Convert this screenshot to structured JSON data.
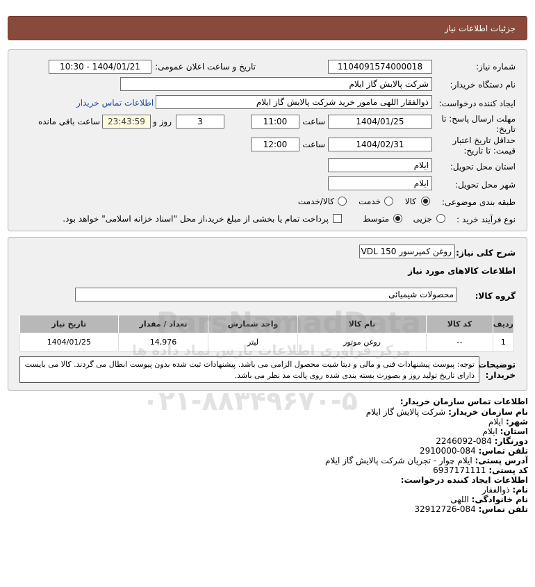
{
  "page_title": "جزئیات اطلاعات نیاز",
  "labels": {
    "need_number": "شماره نیاز:",
    "announce_datetime": "تاریخ و ساعت اعلان عمومی:",
    "buyer_org": "نام دستگاه خریدار:",
    "creator": "ایجاد کننده درخواست:",
    "deadline_line1": "مهلت ارسال پاسخ: تا",
    "deadline_line2": "تاریخ:",
    "hour": "ساعت",
    "days_and": "روز و",
    "remaining": "ساعت باقی مانده",
    "validity_line1": "حداقل تاریخ اعتبار",
    "validity_line2": "قیمت: تا تاریخ:",
    "province": "استان محل تحویل:",
    "city": "شهر محل تحویل:",
    "category": "طبقه بندی موضوعی:",
    "process": "نوع فرآیند خرید :",
    "summary": "شرح کلی نیاز:",
    "goods_info": "اطلاعات کالاهای مورد نیاز",
    "goods_group": "گروه کالا:",
    "notes_line1": "توضیحات",
    "notes_line2": "خریدار:"
  },
  "values": {
    "need_number": "1104091574000018",
    "announce_datetime": "1404/01/21 - 10:30",
    "buyer_org": "شرکت پالایش گاز ایلام",
    "creator": "ذوالفقار اللهی مامور خرید شرکت پالایش گاز ایلام",
    "buyer_contact_link": "اطلاعات تماس خریدار",
    "deadline_date": "1404/01/25",
    "deadline_hour": "11:00",
    "days": "3",
    "timer": "23:43:59",
    "validity_date": "1404/02/31",
    "validity_hour": "12:00",
    "province": "ایلام",
    "city": "ایلام",
    "summary": "روغن کمپرسور VDL 150",
    "goods_group": "محصولات شیمیائی"
  },
  "category_options": [
    "کالا",
    "خدمت",
    "کالا/خدمت"
  ],
  "category_selected": "کالا",
  "process_options": [
    "جزیی",
    "متوسط"
  ],
  "process_selected": "متوسط",
  "payment_note": "پرداخت تمام یا بخشی از مبلغ خرید،از محل \"اسناد خزانه اسلامی\" خواهد بود.",
  "table": {
    "headers": [
      "ردیف",
      "کد کالا",
      "نام کالا",
      "واحد شمارش",
      "تعداد / مقدار",
      "تاریخ نیاز"
    ],
    "rows": [
      [
        "1",
        "--",
        "روغن موتور",
        "لیتر",
        "14,976",
        "1404/01/25"
      ]
    ]
  },
  "notes": "توجه: پیوست پیشنهادات فنی و مالی و دیتا شیت محصول الزامی می باشد. پیشنهادات ثبت شده بدون پیوست ابطال می گردند. کالا می بایست دارای تاریخ تولید روز و بصورت بسته بندی شده روی پالت مد نظر می باشد.",
  "contact": {
    "title": "اطلاعات تماس سازمان خریدار:",
    "org_label": "نام سازمان خریدار:",
    "org_value": "شرکت پالایش گاز ایلام",
    "city_label": "شهر:",
    "city_value": "ایلام",
    "province_label": "استان:",
    "province_value": "ایلام",
    "fax_label": "دورنگار:",
    "fax_value": "084-2246092",
    "phone_label": "تلفن تماس:",
    "phone_value": "084-2910000",
    "address_label": "آدرس پستی:",
    "address_value": "ایلام چوار - تجریان شرکت پالایش گاز ایلام",
    "postal_label": "کد پستی:",
    "postal_value": "6937171111",
    "creator_title": "اطلاعات ایجاد کننده درخواست:",
    "name_label": "نام:",
    "name_value": "ذوالفقار",
    "family_label": "نام خانوادگی:",
    "family_value": "اللهی",
    "creator_phone_label": "تلفن تماس:",
    "creator_phone_value": "084-32912726"
  },
  "watermark": {
    "line1": "ParsNamadData",
    "line2": "مرکز فراوری اطلاعات پارس نماد داده ها",
    "phone": "۰۲۱-۸۸۳۴۹۶۷۰-۵"
  }
}
